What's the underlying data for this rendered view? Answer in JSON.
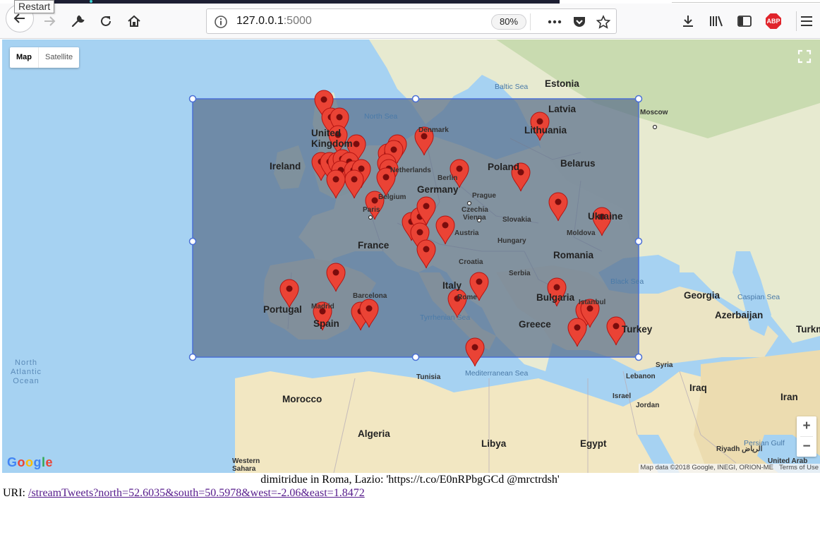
{
  "browser": {
    "tooltip": "Restart",
    "url_host": "127.0.0.1",
    "url_port": ":5000",
    "zoom_level": "80%",
    "abp_label": "ABP",
    "icons": [
      "back-icon",
      "forward-icon",
      "wrench-icon",
      "reload-icon",
      "home-icon",
      "info-icon",
      "more-icon",
      "pocket-icon",
      "star-icon",
      "download-icon",
      "library-icon",
      "sidebar-icon",
      "adblock-icon",
      "menu-icon"
    ]
  },
  "map": {
    "type_buttons": [
      "Map",
      "Satellite"
    ],
    "zoom_in": "+",
    "zoom_out": "−",
    "logo": "Google",
    "attribution": "Map data ©2018 Google, INEGI, ORION-ME",
    "terms": "Terms of Use",
    "labels": {
      "estonia": "Estonia",
      "latvia": "Latvia",
      "lithuania": "Lithuania",
      "belarus": "Belarus",
      "poland": "Poland",
      "ukraine": "Ukraine",
      "moldova": "Moldova",
      "romania": "Romania",
      "hungary": "Hungary",
      "slovakia": "Slovakia",
      "czechia": "Czechia",
      "austria": "Austria",
      "germany": "Germany",
      "netherlands": "Netherlands",
      "belgium": "Belgium",
      "denmark": "Denmark",
      "france": "France",
      "spain": "Spain",
      "portugal": "Portugal",
      "ireland": "Ireland",
      "united_kingdom": "United Kingdom",
      "italy": "Italy",
      "croatia": "Croatia",
      "serbia": "Serbia",
      "bulgaria": "Bulgaria",
      "greece": "Greece",
      "turkey": "Turkey",
      "georgia": "Georgia",
      "azerbaijan": "Azerbaijan",
      "turkmenistan": "Turkm",
      "syria": "Syria",
      "lebanon": "Lebanon",
      "israel": "Israel",
      "jordan": "Jordan",
      "iraq": "Iraq",
      "iran": "Iran",
      "tunisia": "Tunisia",
      "morocco": "Morocco",
      "algeria": "Algeria",
      "libya": "Libya",
      "egypt": "Egypt",
      "western_sahara": "Western Sahara",
      "riyadh": "Riyadh الرياض",
      "united_arab": "United Arab",
      "north_sea": "North Sea",
      "baltic_sea": "Baltic Sea",
      "black_sea": "Black Sea",
      "caspian_sea": "Caspian Sea",
      "tyrrhenian_sea": "Tyrrhenian Sea",
      "mediterranean_sea": "Mediterranean Sea",
      "persian_gulf": "Persian Gulf",
      "north_atlantic_ocean": "North Atlantic Ocean",
      "berlin": "Berlin",
      "paris": "Paris",
      "madrid": "Madrid",
      "barcelona": "Barcelona",
      "prague": "Prague",
      "vienna": "Vienna",
      "rome": "Rome",
      "moscow": "Moscow",
      "istanbul": "Istanbul"
    },
    "marker_count": 45
  },
  "tweet_text": "dimitridue in Roma, Lazio: 'https://t.co/E0nRPbgGCd @mrctrdsh'",
  "uri_label": "URI:",
  "uri_link": "/streamTweets?north=52.6035&south=50.5978&west=-2.06&east=1.8472"
}
